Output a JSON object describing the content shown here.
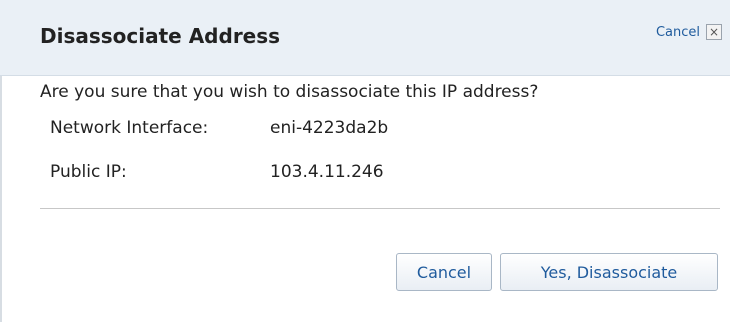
{
  "dialog": {
    "title": "Disassociate Address",
    "close_link_label": "Cancel",
    "close_icon": "close-icon",
    "question": "Are you sure that you wish to disassociate this IP address?",
    "fields": [
      {
        "label": "Network Interface:",
        "value": "eni-4223da2b"
      },
      {
        "label": "Public IP:",
        "value": "103.4.11.246"
      }
    ],
    "buttons": {
      "cancel": "Cancel",
      "confirm": "Yes, Disassociate"
    }
  },
  "colors": {
    "header_bg": "#eaf0f6",
    "link": "#1f5b9d",
    "text": "#222222"
  }
}
